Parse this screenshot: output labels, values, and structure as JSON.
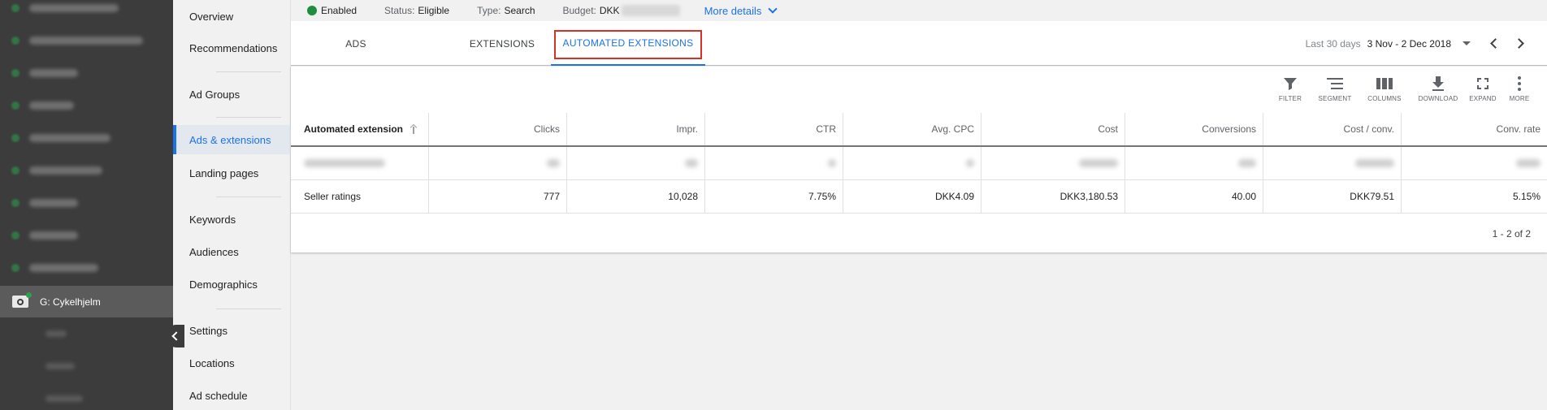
{
  "colors": {
    "accent": "#1a73e8",
    "highlight_box": "#d93025",
    "enabled_dot": "#1e8e3e",
    "sidebar_dark": "#3c3c3c"
  },
  "campaign_tree": {
    "active_item": {
      "label": "G: Cykelhjelm",
      "icon": "search-campaign-icon"
    }
  },
  "menu": {
    "items": [
      {
        "label": "Overview"
      },
      {
        "label": "Recommendations"
      },
      {
        "label": "Ad Groups"
      },
      {
        "label": "Ads & extensions",
        "active": true
      },
      {
        "label": "Landing pages"
      },
      {
        "label": "Keywords"
      },
      {
        "label": "Audiences"
      },
      {
        "label": "Demographics"
      },
      {
        "label": "Settings"
      },
      {
        "label": "Locations"
      },
      {
        "label": "Ad schedule"
      }
    ]
  },
  "status": {
    "enabled": "Enabled",
    "status_label": "Status:",
    "status_value": "Eligible",
    "type_label": "Type:",
    "type_value": "Search",
    "budget_label": "Budget:",
    "budget_value": "DKK",
    "more_details": "More details"
  },
  "tabs": [
    {
      "label": "ADS"
    },
    {
      "label": "EXTENSIONS"
    },
    {
      "label": "AUTOMATED EXTENSIONS",
      "active": true
    }
  ],
  "date_range": {
    "preset": "Last 30 days",
    "range": "3 Nov - 2 Dec 2018"
  },
  "toolbar": {
    "filter": "FILTER",
    "segment": "SEGMENT",
    "columns": "COLUMNS",
    "download": "DOWNLOAD",
    "expand": "EXPAND",
    "more": "MORE"
  },
  "table": {
    "columns": [
      "Automated extension",
      "Clicks",
      "Impr.",
      "CTR",
      "Avg. CPC",
      "Cost",
      "Conversions",
      "Cost / conv.",
      "Conv. rate"
    ],
    "rows": [
      [
        "Seller ratings",
        "777",
        "10,028",
        "7.75%",
        "DKK4.09",
        "DKK3,180.53",
        "40.00",
        "DKK79.51",
        "5.15%"
      ]
    ],
    "pagination": "1 - 2 of 2"
  }
}
